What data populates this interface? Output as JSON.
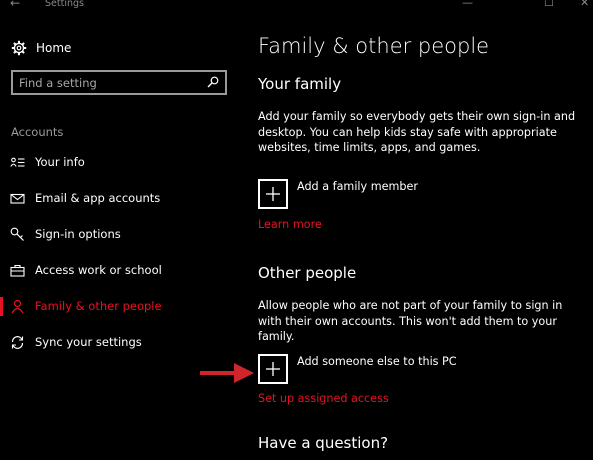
{
  "window": {
    "title": "Settings",
    "back_glyph": "←",
    "controls": {
      "minimize": "—",
      "maximize": "☐",
      "close": "✕"
    }
  },
  "sidebar": {
    "home_label": "Home",
    "home_icon": "gear-icon",
    "search_placeholder": "Find a setting",
    "search_icon": "search-icon",
    "section_label": "Accounts",
    "items": [
      {
        "label": "Your info",
        "icon": "person-card-icon",
        "active": false
      },
      {
        "label": "Email & app accounts",
        "icon": "envelope-icon",
        "active": false
      },
      {
        "label": "Sign-in options",
        "icon": "key-icon",
        "active": false
      },
      {
        "label": "Access work or school",
        "icon": "briefcase-icon",
        "active": false
      },
      {
        "label": "Family & other people",
        "icon": "person-icon",
        "active": true
      },
      {
        "label": "Sync your settings",
        "icon": "sync-icon",
        "active": false
      }
    ]
  },
  "main": {
    "page_title": "Family & other people",
    "your_family": {
      "heading": "Your family",
      "description": "Add your family so everybody gets their own sign-in and desktop. You can help kids stay safe with appropriate websites, time limits, apps, and games.",
      "add_label": "Add a family member",
      "link": "Learn more"
    },
    "other_people": {
      "heading": "Other people",
      "description": "Allow people who are not part of your family to sign in with their own accounts. This won't add them to your family.",
      "add_label": "Add someone else to this PC",
      "link": "Set up assigned access"
    },
    "question_heading": "Have a question?"
  },
  "colors": {
    "background": "#000000",
    "accent": "#e81123",
    "arrow": "#d0252a",
    "muted_text": "#9a9a9a"
  }
}
